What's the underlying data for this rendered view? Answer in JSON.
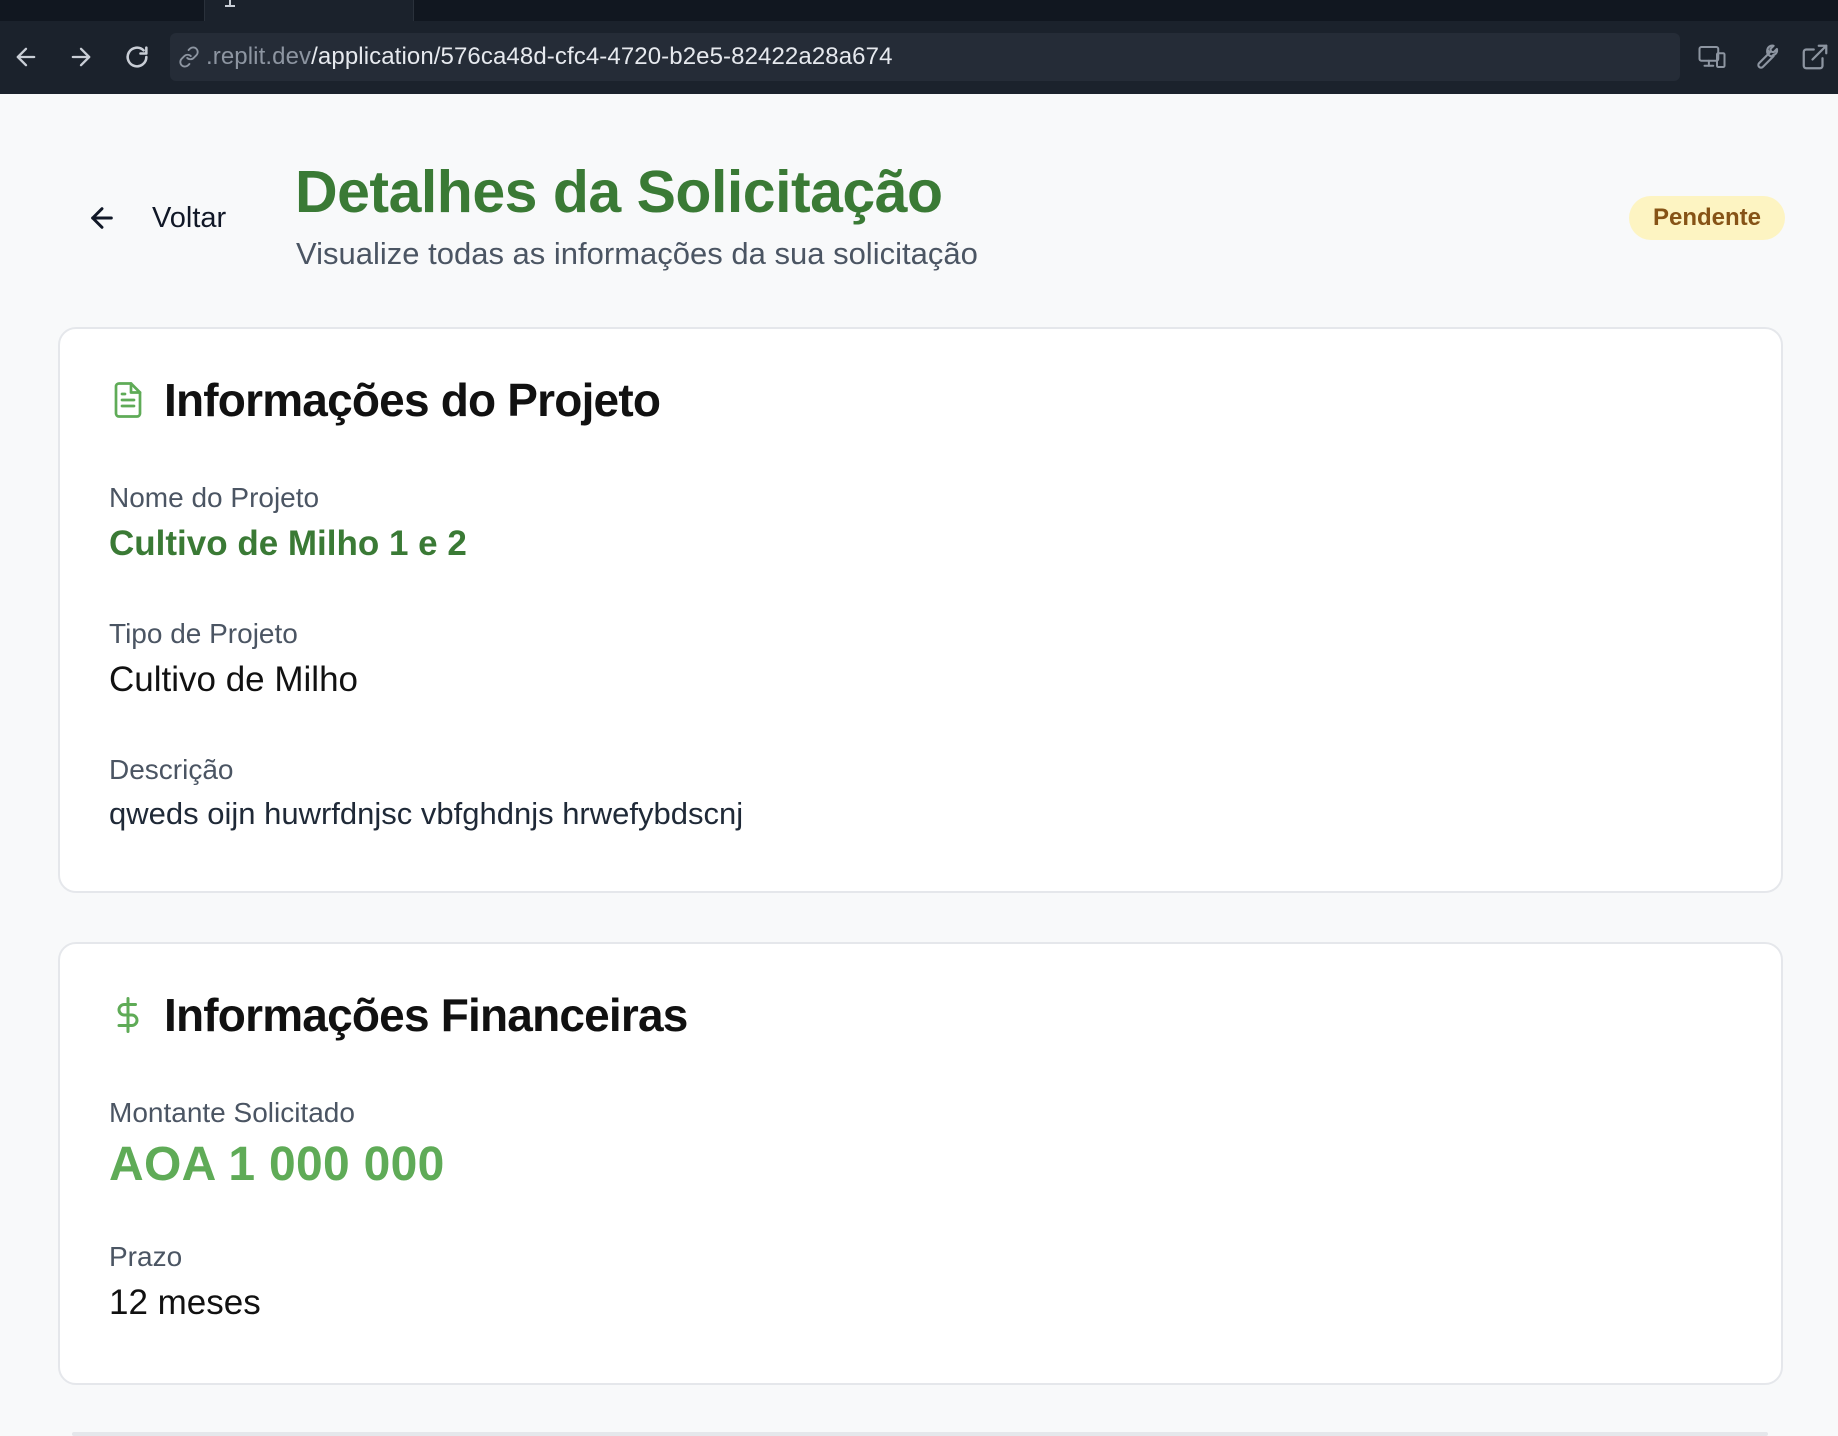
{
  "browser": {
    "url_domain": ".replit.dev",
    "url_path": "/application/576ca48d-cfc4-4720-b2e5-82422a28a674",
    "nav": {
      "back_icon": "arrow-left-icon",
      "forward_icon": "arrow-right-icon",
      "reload_icon": "reload-icon"
    },
    "tools": [
      "devices-icon",
      "wrench-icon",
      "external-link-icon"
    ]
  },
  "header": {
    "back_label": "Voltar",
    "title": "Detalhes da Solicitação",
    "subtitle": "Visualize todas as informações da sua solicitação",
    "status": "Pendente"
  },
  "project_card": {
    "icon": "document-icon",
    "title": "Informações do Projeto",
    "fields": [
      {
        "label": "Nome do Projeto",
        "value": "Cultivo de Milho 1 e 2"
      },
      {
        "label": "Tipo de Projeto",
        "value": "Cultivo de Milho"
      },
      {
        "label": "Descrição",
        "value": "qweds oijn huwrfdnjsc vbfghdnjs hrwefybdscnj"
      }
    ]
  },
  "finance_card": {
    "icon": "dollar-icon",
    "title": "Informações Financeiras",
    "fields": [
      {
        "label": "Montante Solicitado",
        "value": "AOA 1 000 000"
      },
      {
        "label": "Prazo",
        "value": "12 meses"
      }
    ]
  },
  "colors": {
    "brand_green": "#3a7a35",
    "amount_green": "#5fab57",
    "badge_bg": "#fdf4c2",
    "badge_text": "#865316"
  }
}
